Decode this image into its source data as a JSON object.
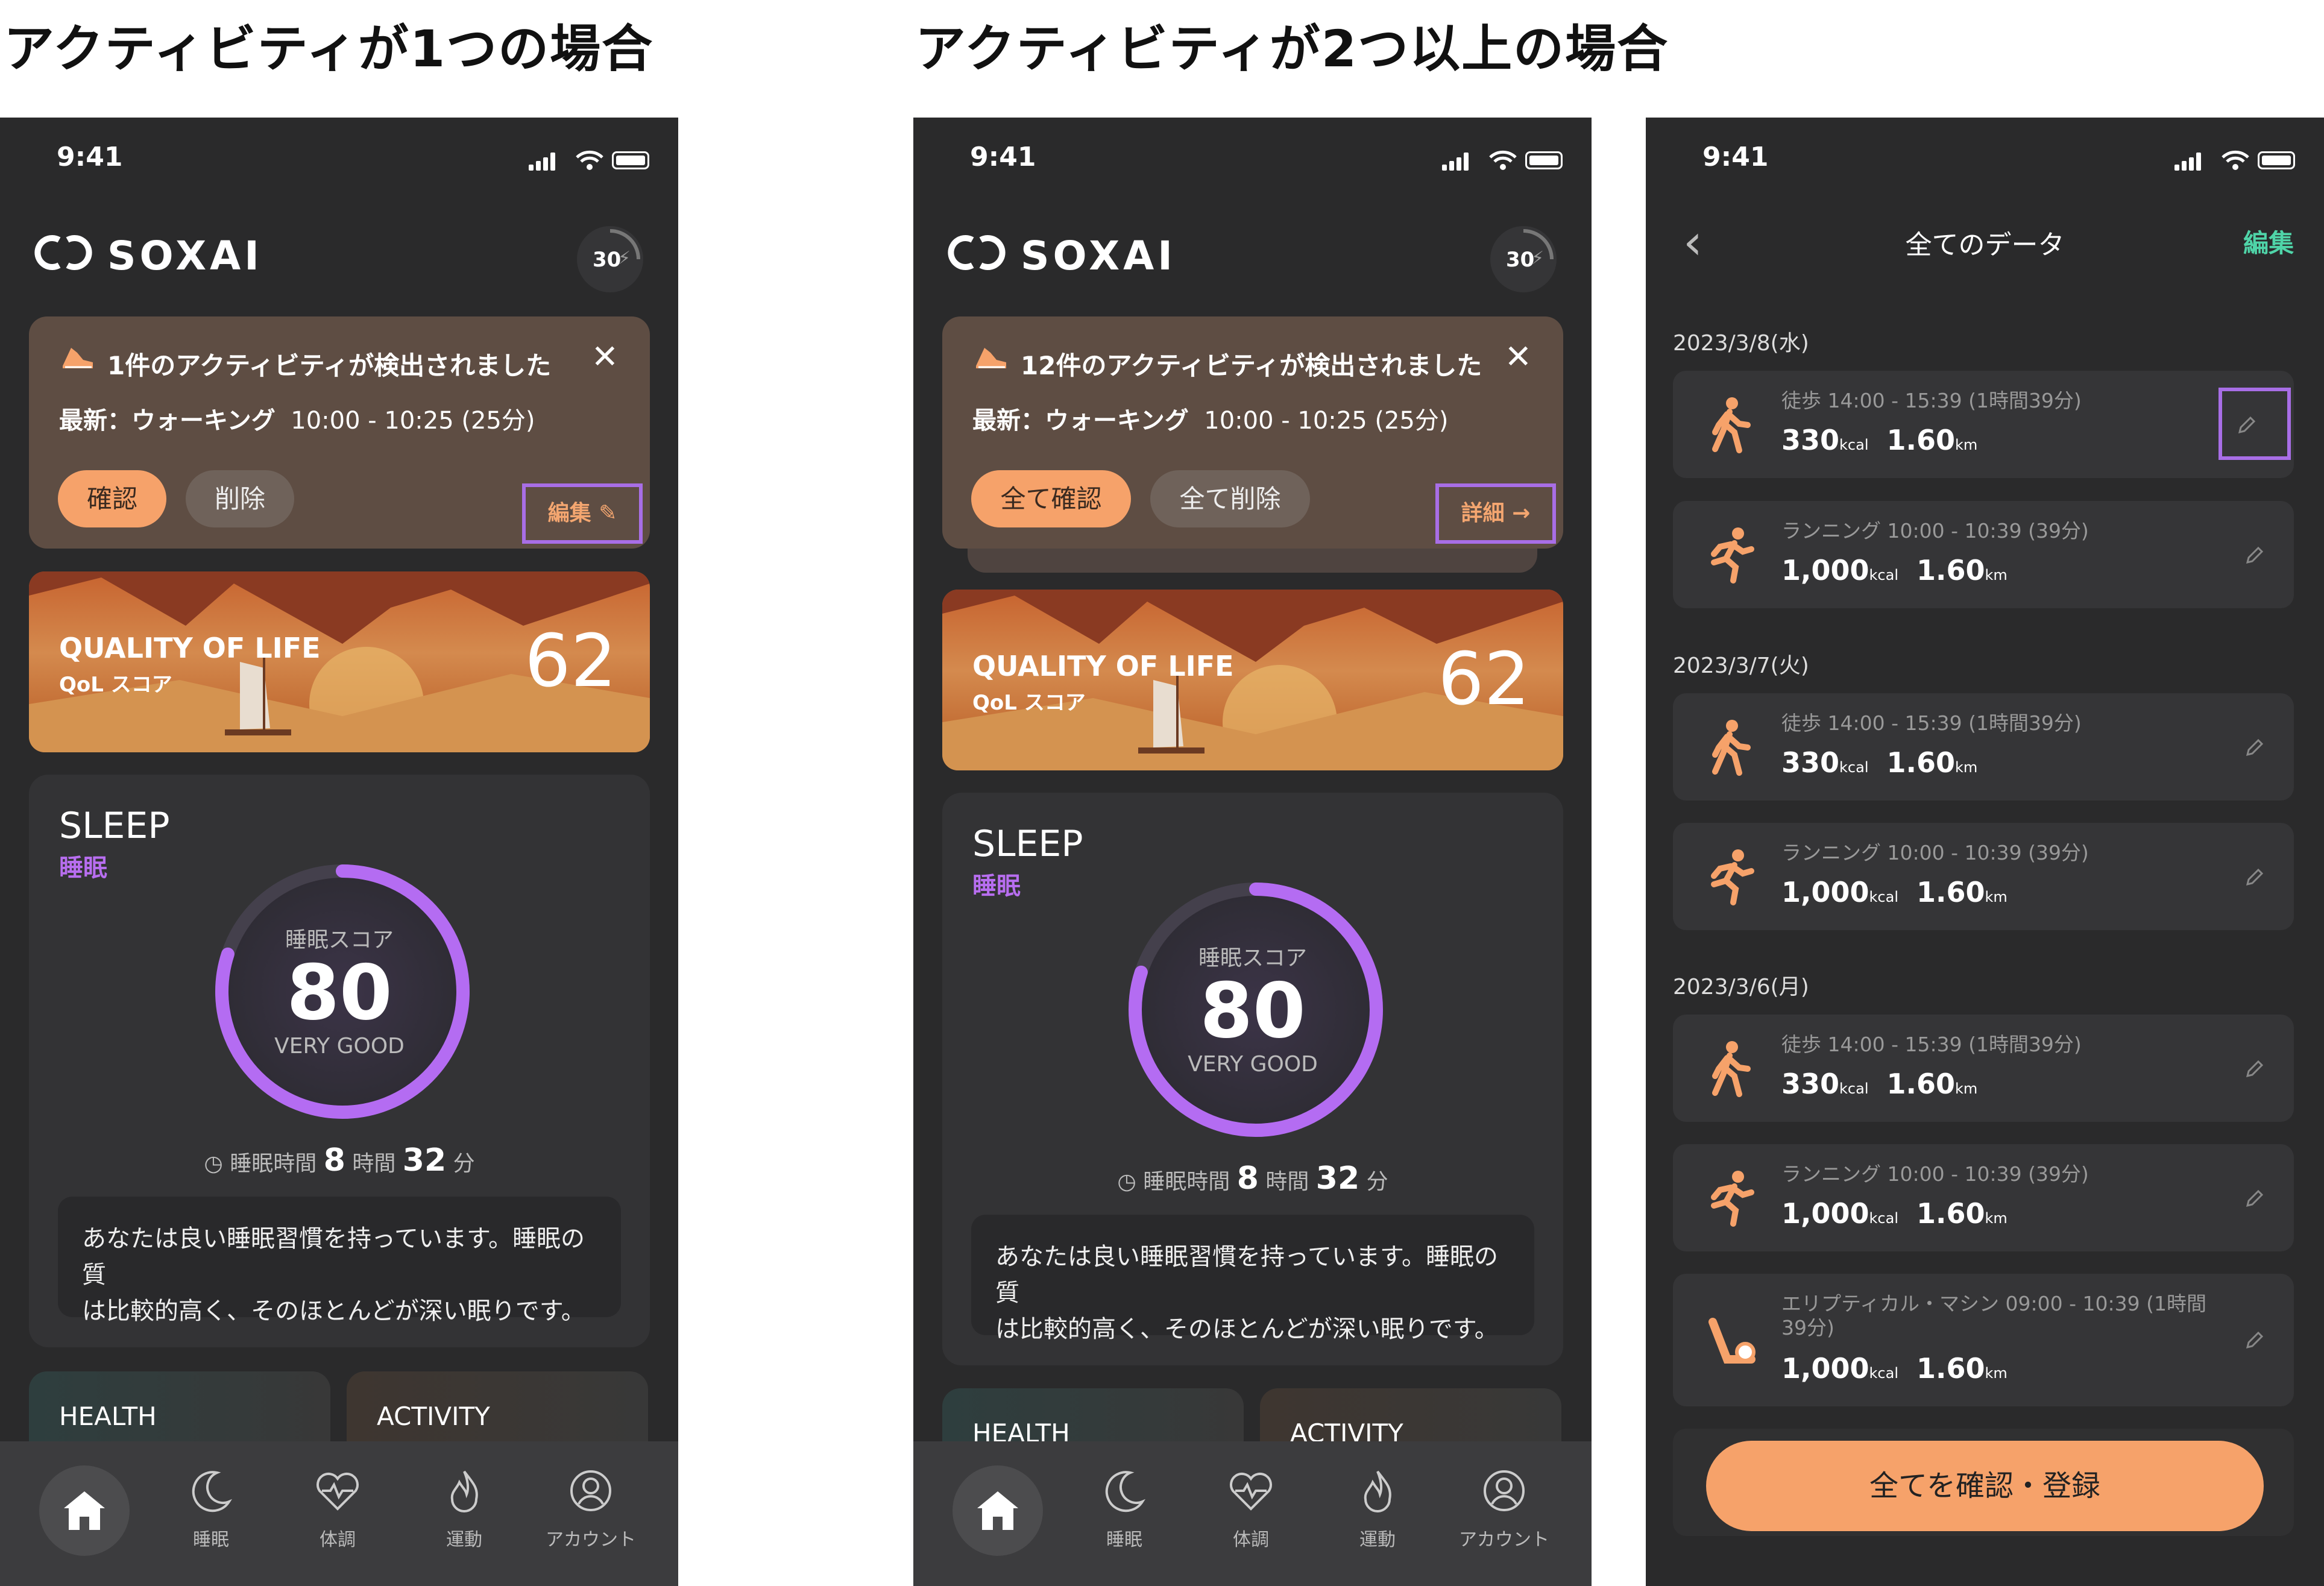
{
  "headings": {
    "single": "アクティビティが1つの場合",
    "multi": "アクティビティが2つ以上の場合"
  },
  "status_time": "9:41",
  "brand": "SOXAI",
  "badge_value": "30",
  "phone1": {
    "notice_title": "1件のアクティビティが検出されました",
    "latest_prefix": "最新：ウォーキング",
    "latest_time": "10:00 - 10:25 (25分)",
    "confirm_label": "確認",
    "delete_label": "削除",
    "edit_label": "編集"
  },
  "phone2": {
    "notice_title": "12件のアクティビティが検出されました",
    "latest_prefix": "最新：ウォーキング",
    "latest_time": "10:00 - 10:25 (25分)",
    "confirm_label": "全て確認",
    "delete_label": "全て削除",
    "detail_label": "詳細"
  },
  "qol": {
    "title": "QUALITY OF LIFE",
    "sub": "QoL スコア",
    "score": "62"
  },
  "sleep": {
    "title": "SLEEP",
    "sub": "睡眠",
    "score_label": "睡眠スコア",
    "score": "80",
    "score_fraction": 0.8,
    "grade": "VERY GOOD",
    "time_label": "睡眠時間",
    "hours": "8",
    "hours_unit": "時間",
    "minutes": "32",
    "minutes_unit": "分",
    "comment_line1": "あなたは良い睡眠習慣を持っています。睡眠の質",
    "comment_line2": "は比較的高く、そのほとんどが深い眠りです。"
  },
  "mini_cards": {
    "health": "HEALTH",
    "activity": "ACTIVITY"
  },
  "tabs": [
    "睡眠",
    "体調",
    "運動",
    "アカウント"
  ],
  "list_page": {
    "title": "全てのデータ",
    "edit_label": "編集",
    "dates": [
      "2023/3/8(水)",
      "2023/3/7(火)",
      "2023/3/6(月)"
    ],
    "rows": [
      {
        "label": "徒歩 14:00 - 15:39 (1時間39分)",
        "kcal": "330",
        "km": "1.60"
      },
      {
        "label": "ランニング 10:00 - 10:39 (39分)",
        "kcal": "1,000",
        "km": "1.60"
      },
      {
        "label": "徒歩 14:00 - 15:39 (1時間39分)",
        "kcal": "330",
        "km": "1.60"
      },
      {
        "label": "ランニング 10:00 - 10:39 (39分)",
        "kcal": "1,000",
        "km": "1.60"
      },
      {
        "label": "徒歩 14:00 - 15:39 (1時間39分)",
        "kcal": "330",
        "km": "1.60"
      },
      {
        "label": "ランニング 10:00 - 10:39 (39分)",
        "kcal": "1,000",
        "km": "1.60"
      },
      {
        "label": "エリプティカル・マシン 09:00 - 10:39 (1時間39分)",
        "kcal": "1,000",
        "km": "1.60"
      }
    ],
    "unit_kcal": "kcal",
    "unit_km": "km",
    "cta_label": "全てを確認・登録"
  },
  "colors": {
    "accent": "#f6a26a",
    "purple": "#a86ee6",
    "green": "#4fd4a8",
    "bg": "#2a2a2b"
  }
}
